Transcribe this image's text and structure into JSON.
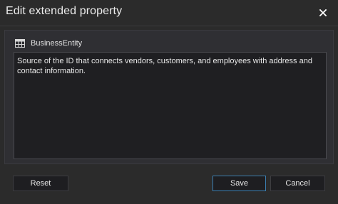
{
  "dialog": {
    "title": "Edit extended property",
    "close_icon": "close-icon"
  },
  "entity": {
    "icon": "table-icon",
    "name": "BusinessEntity"
  },
  "description": {
    "value": "Source of the ID that connects vendors, customers, and employees with address and contact information."
  },
  "buttons": {
    "reset": "Reset",
    "save": "Save",
    "cancel": "Cancel"
  },
  "colors": {
    "background": "#2b2b2b",
    "panel": "#2f2f33",
    "textarea": "#1f1f22",
    "accent_border": "#3c7fb1"
  }
}
